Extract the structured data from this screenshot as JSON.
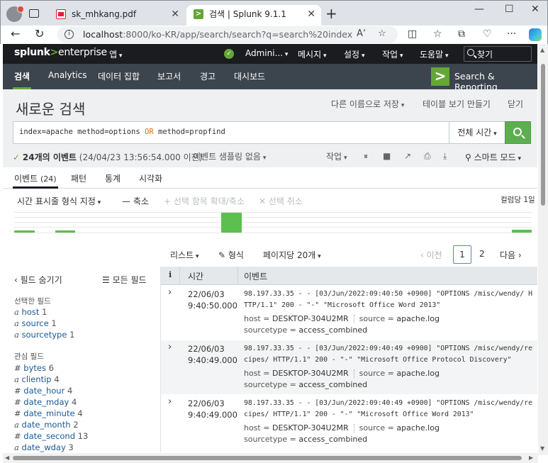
{
  "browser": {
    "tabs": [
      {
        "title": "sk_mhkang.pdf",
        "close": "✕"
      },
      {
        "title": "검색 | Splunk 9.1.1",
        "close": "✕"
      }
    ],
    "url_host": "localhost",
    "url_rest": ":8000/ko-KR/app/search/search?q=search%20index%3Dapache%...",
    "window_controls": [
      "—",
      "☐",
      "✕"
    ]
  },
  "splunk_header": {
    "logo_splunk": "splunk",
    "logo_gt": ">",
    "logo_enterprise": "enterprise",
    "apps_menu": "앱",
    "status_icon": "✓",
    "user_menu": "Admini...",
    "messages_menu": "메시지",
    "settings_menu": "설정",
    "activity_menu": "작업",
    "help_menu": "도움말",
    "find_label": "찾기"
  },
  "app_bar": {
    "items": [
      "검색",
      "Analytics",
      "데이터 집합",
      "보고서",
      "경고",
      "대시보드"
    ],
    "logo_glyph": ">",
    "app_name": "Search & Reporting"
  },
  "search": {
    "title": "새로운 검색",
    "save_as": "다른 이름으로 저장",
    "create_table_view": "테이블 보기 만들기",
    "close": "닫기",
    "query_a": "index=apache method=options ",
    "query_or": "OR",
    "query_b": " method=propfind",
    "time_range": "전체 시간",
    "status_check": "✓",
    "status_count": "24개의 이벤트",
    "status_time": "(24/04/23 13:56:54.000 이전)",
    "sampling": "이벤트 샘플링 없음",
    "job": "작업",
    "smart_mode": "스마트 모드"
  },
  "result_tabs": {
    "events_label": "이벤트",
    "events_count": "(24)",
    "patterns": "패턴",
    "statistics": "통계",
    "visualization": "시각화"
  },
  "timeline_controls": {
    "format": "시간 표시줄 형식 지정",
    "zoom_out": "축소",
    "zoom_selection": "선택 항목 확대/축소",
    "deselect": "선택 취소",
    "per_column": "컬럼당 1일"
  },
  "timeline_bars": [
    {
      "pos": 0.0,
      "width": 0.04,
      "level": 0.1
    },
    {
      "pos": 0.08,
      "width": 0.038,
      "level": 0.1
    },
    {
      "pos": 0.4,
      "width": 0.04,
      "level": 1.0
    },
    {
      "pos": 0.962,
      "width": 0.038,
      "level": 0.15
    }
  ],
  "pager": {
    "list": "리스트",
    "format": "형식",
    "per_page": "페이지당 20개",
    "prev": "‹ 이전",
    "page1": "1",
    "page2": "2",
    "next": "다음 ›"
  },
  "fields": {
    "hide": "‹ 필드 숨기기",
    "all": "모든 필드",
    "selected_header": "선택한 필드",
    "selected": [
      {
        "type": "a",
        "name": "host",
        "count": "1"
      },
      {
        "type": "a",
        "name": "source",
        "count": "1"
      },
      {
        "type": "a",
        "name": "sourcetype",
        "count": "1"
      }
    ],
    "interesting_header": "관심 필드",
    "interesting": [
      {
        "type": "#",
        "name": "bytes",
        "count": "6"
      },
      {
        "type": "a",
        "name": "clientip",
        "count": "4"
      },
      {
        "type": "#",
        "name": "date_hour",
        "count": "4"
      },
      {
        "type": "#",
        "name": "date_mday",
        "count": "4"
      },
      {
        "type": "#",
        "name": "date_minute",
        "count": "4"
      },
      {
        "type": "a",
        "name": "date_month",
        "count": "2"
      },
      {
        "type": "#",
        "name": "date_second",
        "count": "13"
      },
      {
        "type": "a",
        "name": "date_wday",
        "count": "3"
      }
    ]
  },
  "events_table": {
    "col_info": "i",
    "col_time": "시간",
    "col_event": "이벤트",
    "rows": [
      {
        "date": "22/06/03",
        "time": "9:40:50.000",
        "raw": "98.197.33.35 - - [03/Jun/2022:09:40:50 +0900] \"OPTIONS /misc/wendy/ HTTP/1.1\" 200 - \"-\" \"Microsoft Office Word 2013\"",
        "host": "DESKTOP-304U2MR",
        "source": "apache.log",
        "sourcetype": "access_combined"
      },
      {
        "date": "22/06/03",
        "time": "9:40:49.000",
        "raw": "98.197.33.35 - - [03/Jun/2022:09:40:49 +0900] \"OPTIONS /misc/wendy/recipes/ HTTP/1.1\" 200 - \"-\" \"Microsoft Office Protocol Discovery\"",
        "host": "DESKTOP-304U2MR",
        "source": "apache.log",
        "sourcetype": "access_combined"
      },
      {
        "date": "22/06/03",
        "time": "9:40:49.000",
        "raw": "98.197.33.35 - - [03/Jun/2022:09:40:49 +0900] \"OPTIONS /misc/wendy/recipes/ HTTP/1.1\" 200 - \"-\" \"Microsoft Office Word 2013\"",
        "host": "DESKTOP-304U2MR",
        "source": "apache.log",
        "sourcetype": "access_combined"
      }
    ]
  },
  "labels": {
    "host": "host =",
    "source": "source =",
    "sourcetype": "sourcetype ="
  },
  "colors": {
    "splunk_green": "#65a637",
    "header_dark": "#1a1c20",
    "app_bar": "#3c444d",
    "link_blue": "#1a5a96"
  }
}
